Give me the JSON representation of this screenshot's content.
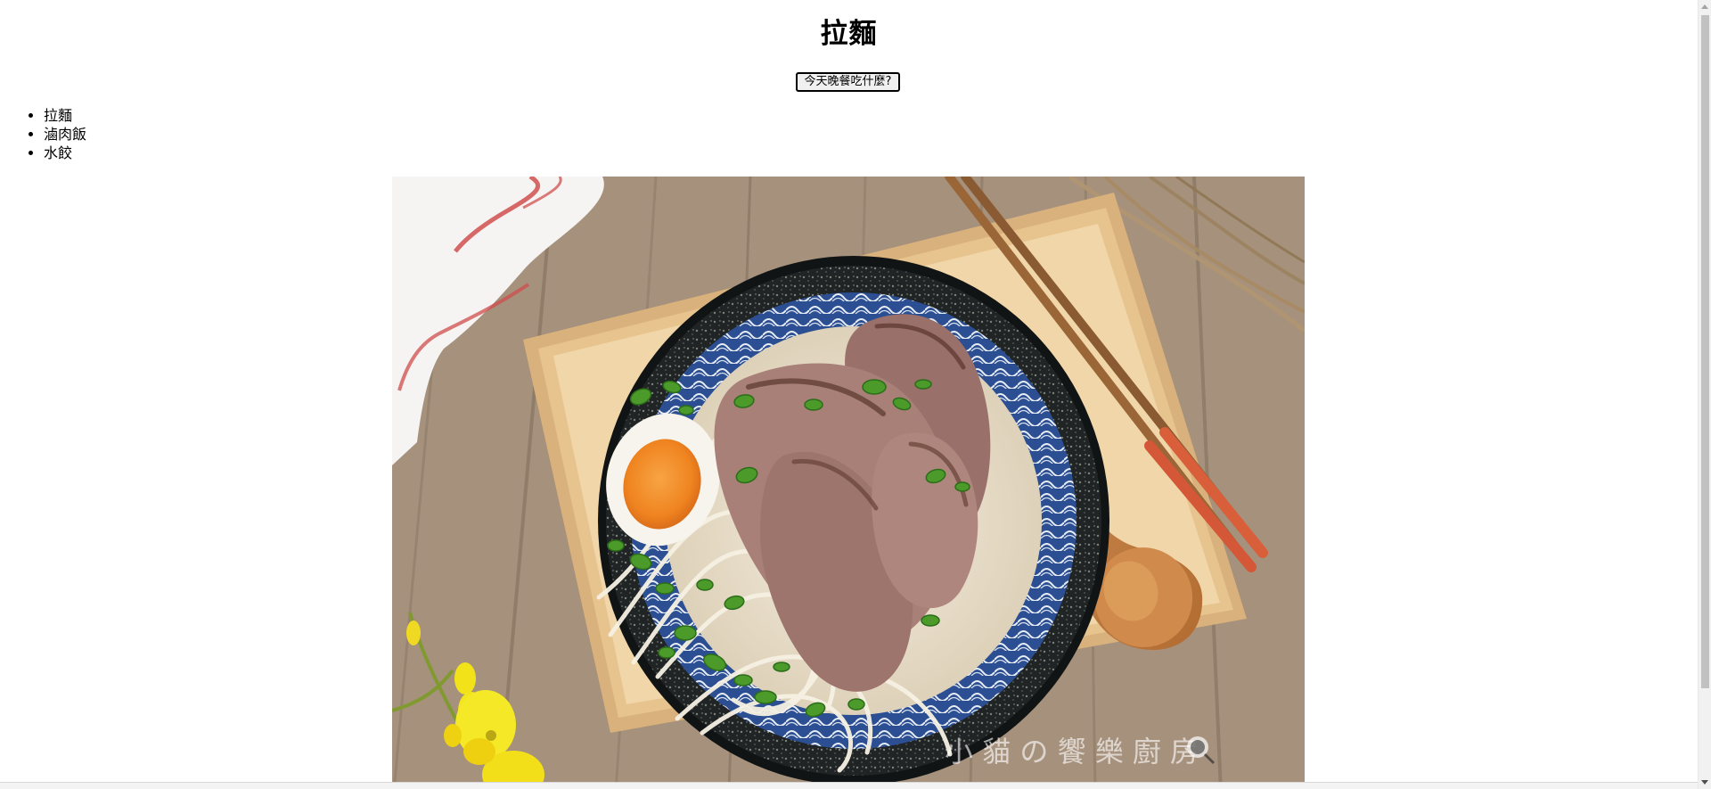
{
  "page": {
    "title": "拉麵",
    "button_label": "今天晚餐吃什麼?"
  },
  "menu": {
    "items": [
      {
        "label": "拉麵"
      },
      {
        "label": "滷肉飯"
      },
      {
        "label": "水餃"
      }
    ]
  },
  "image": {
    "alt": "拉麵",
    "watermark": "小 貓 の 饗 樂 廚 房"
  },
  "colors": {
    "wood_table": "#a6917c",
    "tray": "#d9b07d",
    "bowl_outer": "#1e2223",
    "bowl_pattern": "#23498d",
    "broth": "#eee6d1",
    "pork": "#a77e77",
    "egg_yolk": "#f08b24",
    "scallion": "#4b9a2a",
    "napkin": "#f4f3f1",
    "napkin_stripe": "#cf4b4d",
    "flower": "#f3e51d"
  }
}
